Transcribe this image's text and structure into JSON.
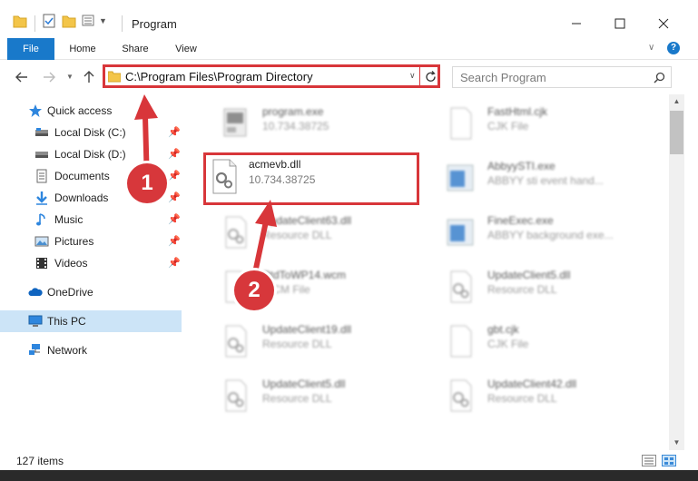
{
  "window": {
    "title": "Program",
    "minimize_icon": "minimize-icon",
    "maximize_icon": "maximize-icon",
    "close_icon": "close-icon"
  },
  "ribbon": {
    "tabs": [
      {
        "label": "File"
      },
      {
        "label": "Home"
      },
      {
        "label": "Share"
      },
      {
        "label": "View"
      }
    ],
    "accent": "#1979ca"
  },
  "address": {
    "path": "C:\\Program Files\\Program Directory",
    "search_placeholder": "Search Program"
  },
  "sidebar": {
    "items": [
      {
        "label": "Quick access",
        "icon": "star-icon"
      },
      {
        "label": "Local Disk (C:)",
        "icon": "drive-icon",
        "pinned": true
      },
      {
        "label": "Local Disk (D:)",
        "icon": "drive-icon",
        "pinned": true
      },
      {
        "label": "Documents",
        "icon": "documents-icon",
        "pinned": true
      },
      {
        "label": "Downloads",
        "icon": "downloads-icon",
        "pinned": true
      },
      {
        "label": "Music",
        "icon": "music-icon",
        "pinned": true
      },
      {
        "label": "Pictures",
        "icon": "pictures-icon",
        "pinned": true
      },
      {
        "label": "Videos",
        "icon": "videos-icon",
        "pinned": true
      },
      {
        "label": "OneDrive",
        "icon": "cloud-icon"
      },
      {
        "label": "This PC",
        "icon": "computer-icon",
        "selected": true
      },
      {
        "label": "Network",
        "icon": "network-icon"
      }
    ]
  },
  "files": [
    {
      "name": "program.exe",
      "sub": "10.734.38725"
    },
    {
      "name": "FastHtml.cjk",
      "sub": "CJK File"
    },
    {
      "name": "acmevb.dll",
      "sub": "10.734.38725"
    },
    {
      "name": "AbbyySTI.exe",
      "sub": "ABBYY sti event hand..."
    },
    {
      "name": "UpdateClient63.dll",
      "sub": "Resource DLL"
    },
    {
      "name": "FineExec.exe",
      "sub": "ABBYY background exe..."
    },
    {
      "name": "RtdToWP14.wcm",
      "sub": "WCM File"
    },
    {
      "name": "UpdateClient5.dll",
      "sub": "Resource DLL"
    },
    {
      "name": "UpdateClient19.dll",
      "sub": "Resource DLL"
    },
    {
      "name": "gbt.cjk",
      "sub": "CJK File"
    },
    {
      "name": "UpdateClient5.dll",
      "sub": "Resource DLL"
    },
    {
      "name": "UpdateClient42.dll",
      "sub": "Resource DLL"
    }
  ],
  "status": {
    "count": "127 items"
  },
  "annotations": {
    "step1": "1",
    "step2": "2",
    "color": "#d8363a"
  }
}
